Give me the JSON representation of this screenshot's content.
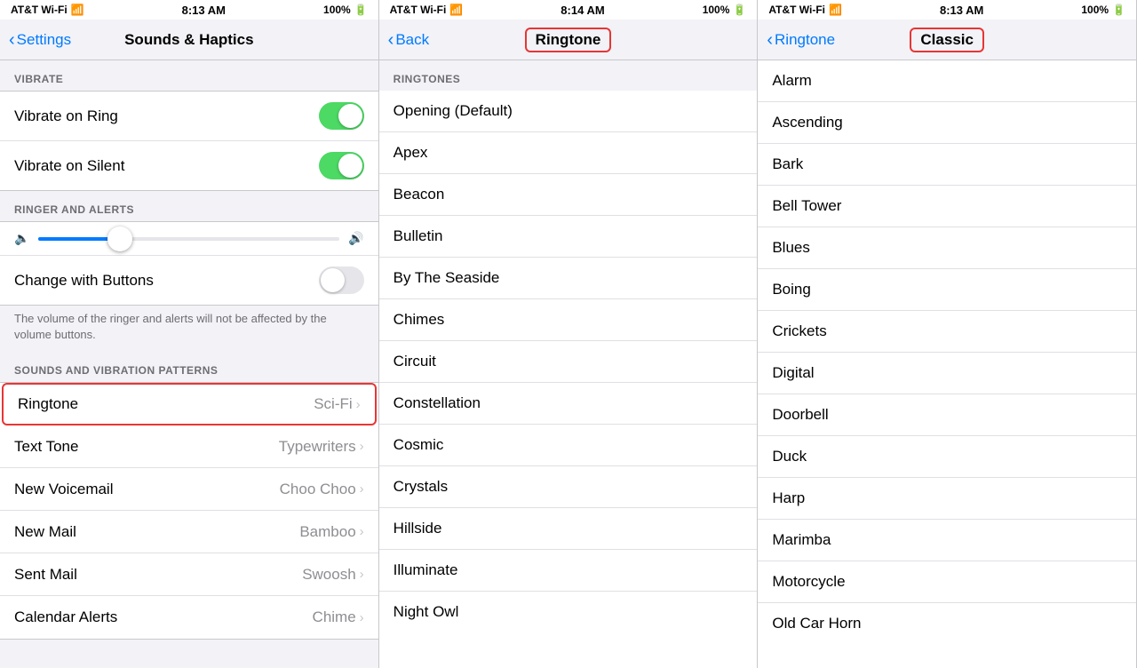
{
  "panels": [
    {
      "id": "panel-sounds-haptics",
      "statusBar": {
        "carrier": "AT&T Wi-Fi",
        "time": "8:13 AM",
        "battery": "100%"
      },
      "navBar": {
        "backLabel": "Settings",
        "title": "Sounds & Haptics",
        "outlined": false
      },
      "sections": [
        {
          "id": "vibrate-section",
          "header": "VIBRATE",
          "cells": [
            {
              "id": "vibrate-on-ring",
              "label": "Vibrate on Ring",
              "type": "toggle",
              "toggleOn": true
            },
            {
              "id": "vibrate-on-silent",
              "label": "Vibrate on Silent",
              "type": "toggle",
              "toggleOn": true
            }
          ]
        },
        {
          "id": "ringer-alerts-section",
          "header": "RINGER AND ALERTS",
          "hasSlider": true,
          "sliderPercent": 27,
          "cells": [
            {
              "id": "change-with-buttons",
              "label": "Change with Buttons",
              "type": "toggle",
              "toggleOn": false
            }
          ],
          "note": "The volume of the ringer and alerts will not be affected by the volume buttons."
        },
        {
          "id": "sounds-vibration-section",
          "header": "SOUNDS AND VIBRATION PATTERNS",
          "cells": [
            {
              "id": "ringtone",
              "label": "Ringtone",
              "value": "Sci-Fi",
              "type": "nav",
              "outlined": true
            },
            {
              "id": "text-tone",
              "label": "Text Tone",
              "value": "Typewriters",
              "type": "nav"
            },
            {
              "id": "new-voicemail",
              "label": "New Voicemail",
              "value": "Choo Choo",
              "type": "nav"
            },
            {
              "id": "new-mail",
              "label": "New Mail",
              "value": "Bamboo",
              "type": "nav"
            },
            {
              "id": "sent-mail",
              "label": "Sent Mail",
              "value": "Swoosh",
              "type": "nav"
            },
            {
              "id": "calendar-alerts",
              "label": "Calendar Alerts",
              "value": "Chime",
              "type": "nav"
            }
          ]
        }
      ]
    },
    {
      "id": "panel-ringtone",
      "statusBar": {
        "carrier": "AT&T Wi-Fi",
        "time": "8:14 AM",
        "battery": "100%"
      },
      "navBar": {
        "backLabel": "Back",
        "title": "Ringtone",
        "outlined": true
      },
      "sectionHeader": "RINGTONES",
      "ringtones": [
        "Opening (Default)",
        "Apex",
        "Beacon",
        "Bulletin",
        "By The Seaside",
        "Chimes",
        "Circuit",
        "Constellation",
        "Cosmic",
        "Crystals",
        "Hillside",
        "Illuminate",
        "Night Owl"
      ]
    },
    {
      "id": "panel-classic",
      "statusBar": {
        "carrier": "AT&T Wi-Fi",
        "time": "8:13 AM",
        "battery": "100%"
      },
      "navBar": {
        "backLabel": "Ringtone",
        "title": "Classic",
        "outlined": true
      },
      "ringtones": [
        "Alarm",
        "Ascending",
        "Bark",
        "Bell Tower",
        "Blues",
        "Boing",
        "Crickets",
        "Digital",
        "Doorbell",
        "Duck",
        "Harp",
        "Marimba",
        "Motorcycle",
        "Old Car Horn"
      ]
    }
  ]
}
